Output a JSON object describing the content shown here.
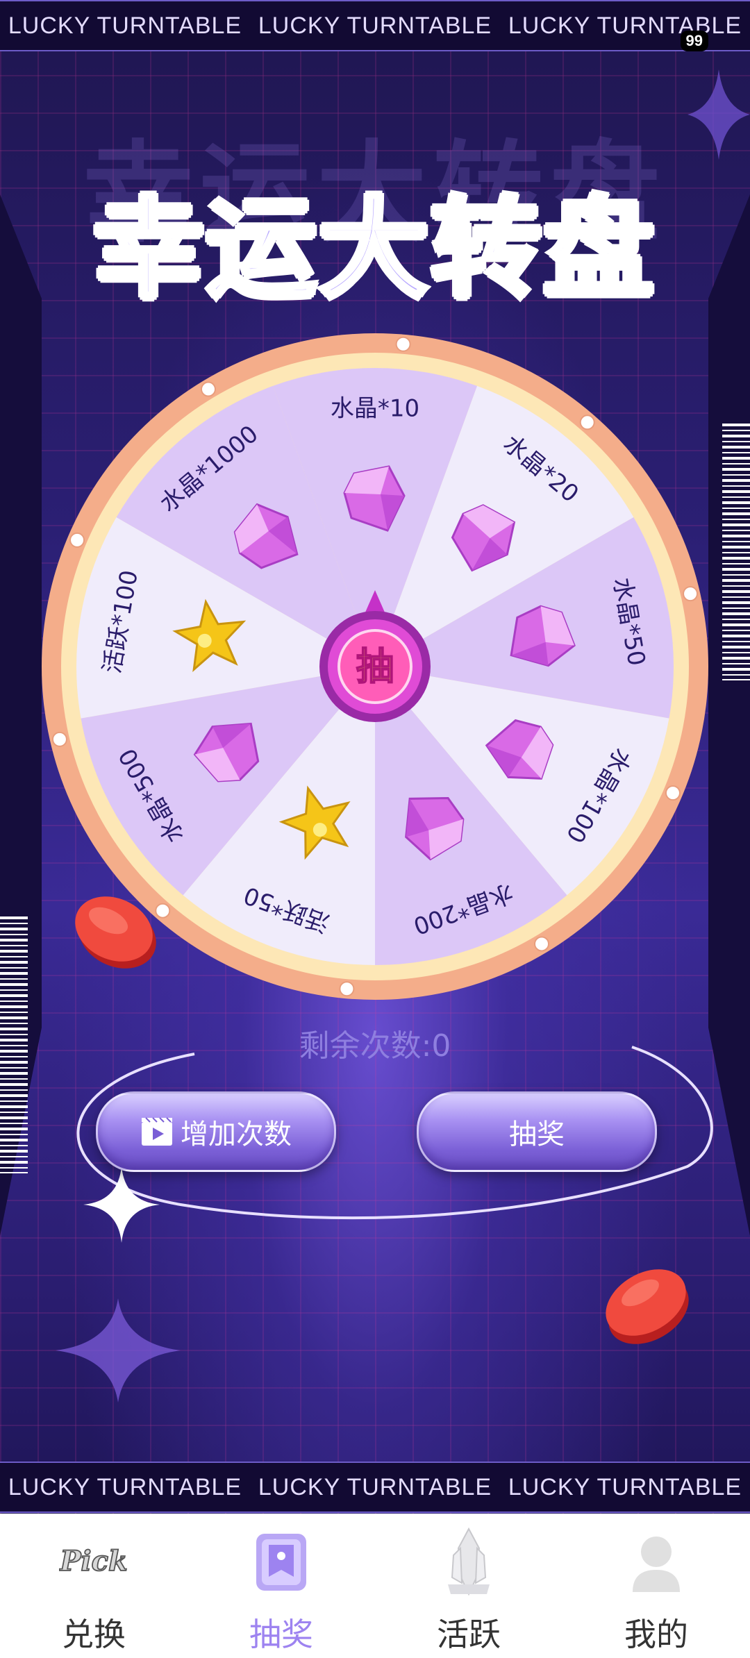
{
  "marquee": {
    "top_items": [
      "LUCKY TURNTABLE",
      "LUCKY TURNTABLE",
      "LUCKY TURNTABLE"
    ],
    "bottom_items": [
      "LUCKY TURNTABLE",
      "LUCKY TURNTABLE",
      "LUCKY TURNTABLE"
    ]
  },
  "status_bar": {
    "badge": "99"
  },
  "title": "幸运大转盘",
  "wheel": {
    "center_label": "抽",
    "segments": [
      {
        "label": "水晶*10",
        "icon": "crystal-icon"
      },
      {
        "label": "水晶*20",
        "icon": "crystal-icon"
      },
      {
        "label": "水晶*50",
        "icon": "crystal-icon"
      },
      {
        "label": "水晶*100",
        "icon": "crystal-icon"
      },
      {
        "label": "水晶*200",
        "icon": "crystal-icon"
      },
      {
        "label": "活跃*50",
        "icon": "star-icon"
      },
      {
        "label": "水晶*500",
        "icon": "crystal-icon"
      },
      {
        "label": "活跃*100",
        "icon": "star-icon"
      },
      {
        "label": "水晶*1000",
        "icon": "crystal-icon"
      }
    ]
  },
  "remaining_text": "剩余次数:0",
  "buttons": {
    "add_label": "增加次数",
    "draw_label": "抽奖"
  },
  "tabbar": {
    "items": [
      {
        "label": "兑换",
        "icon": "pick-logo-icon",
        "active": false
      },
      {
        "label": "抽奖",
        "icon": "lottery-icon",
        "active": true
      },
      {
        "label": "活跃",
        "icon": "crystal-trophy-icon",
        "active": false
      },
      {
        "label": "我的",
        "icon": "user-icon",
        "active": false
      }
    ]
  },
  "colors": {
    "accent": "#9d83f0",
    "wheel_rim": "#f4ad8a",
    "wheel_inner_rim": "#fde7b6",
    "segment_light": "#f0ecfb",
    "segment_dark": "#dcc7f7",
    "center_button": "#c531c8"
  }
}
